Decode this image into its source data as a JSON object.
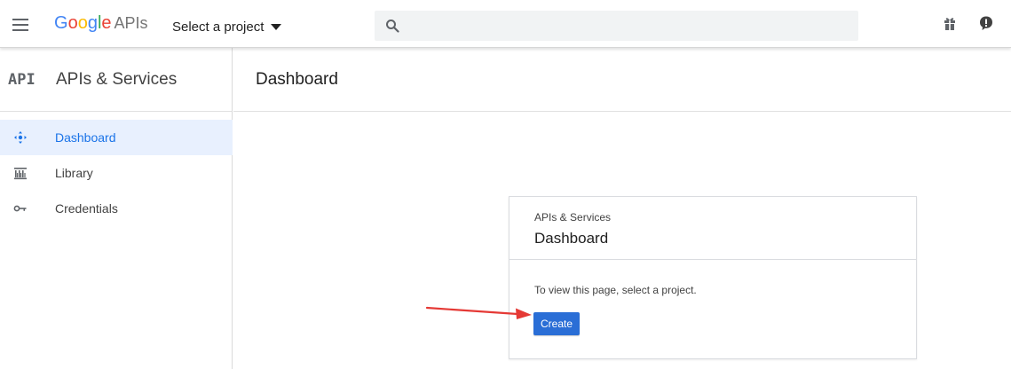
{
  "topbar": {
    "logo_letters": [
      {
        "ch": "G",
        "color": "#4285f4"
      },
      {
        "ch": "o",
        "color": "#ea4335"
      },
      {
        "ch": "o",
        "color": "#fbbc05"
      },
      {
        "ch": "g",
        "color": "#4285f4"
      },
      {
        "ch": "l",
        "color": "#34a853"
      },
      {
        "ch": "e",
        "color": "#ea4335"
      }
    ],
    "logo_suffix": "APIs",
    "project_select_label": "Select a project",
    "search": {
      "value": "",
      "placeholder": ""
    },
    "icons": [
      "menu-icon",
      "search-icon",
      "gift-icon",
      "notification-icon"
    ]
  },
  "sidebar": {
    "logo_text": "API",
    "title": "APIs & Services",
    "items": [
      {
        "label": "Dashboard",
        "icon": "dashboard-icon",
        "active": true
      },
      {
        "label": "Library",
        "icon": "library-icon",
        "active": false
      },
      {
        "label": "Credentials",
        "icon": "key-icon",
        "active": false
      }
    ]
  },
  "main": {
    "title": "Dashboard",
    "card": {
      "kicker": "APIs & Services",
      "title": "Dashboard",
      "text": "To view this page, select a project.",
      "button_label": "Create"
    }
  },
  "colors": {
    "accent": "#1a73e8",
    "button": "#2a6ed6",
    "active_bg": "#e8f0fe",
    "annotation_arrow": "#e53935"
  }
}
